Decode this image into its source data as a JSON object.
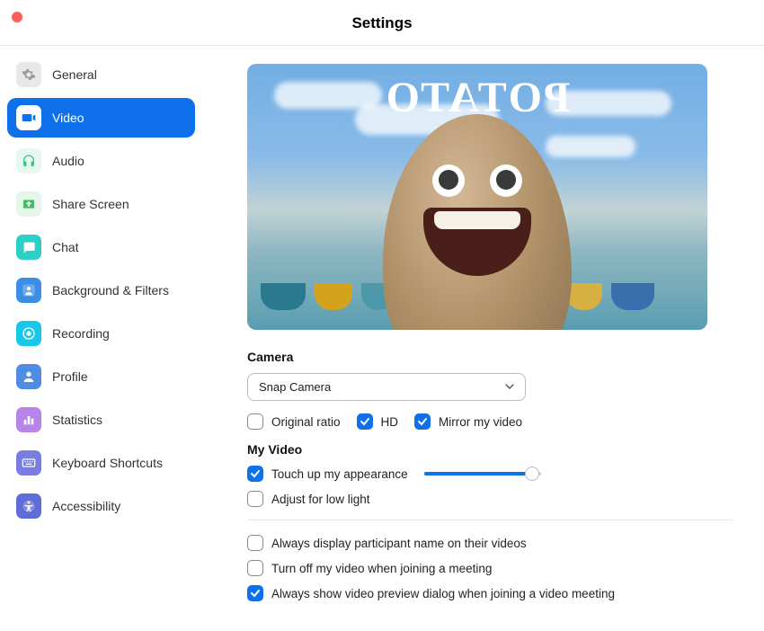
{
  "title": "Settings",
  "sidebar": {
    "items": [
      {
        "label": "General",
        "icon": "gear",
        "bg": "#e8e8e8",
        "fg": "#9a9a9a",
        "active": false
      },
      {
        "label": "Video",
        "icon": "video",
        "bg": "#ffffff",
        "fg": "#0e71eb",
        "active": true
      },
      {
        "label": "Audio",
        "icon": "headphones",
        "bg": "#e8f8f0",
        "fg": "#34c77b",
        "active": false
      },
      {
        "label": "Share Screen",
        "icon": "share",
        "bg": "#e4f7e9",
        "fg": "#3fbf63",
        "active": false
      },
      {
        "label": "Chat",
        "icon": "chat",
        "bg": "#2dd0c4",
        "fg": "#ffffff",
        "active": false
      },
      {
        "label": "Background & Filters",
        "icon": "person-sq",
        "bg": "#3b8ee5",
        "fg": "#ffffff",
        "active": false
      },
      {
        "label": "Recording",
        "icon": "record",
        "bg": "#18c8e8",
        "fg": "#ffffff",
        "active": false
      },
      {
        "label": "Profile",
        "icon": "person",
        "bg": "#4f8de4",
        "fg": "#ffffff",
        "active": false
      },
      {
        "label": "Statistics",
        "icon": "bars",
        "bg": "#b884e8",
        "fg": "#ffffff",
        "active": false
      },
      {
        "label": "Keyboard Shortcuts",
        "icon": "keyboard",
        "bg": "#7a7de0",
        "fg": "#ffffff",
        "active": false
      },
      {
        "label": "Accessibility",
        "icon": "a11y",
        "bg": "#5f6dd8",
        "fg": "#ffffff",
        "active": false
      }
    ]
  },
  "preview": {
    "overlay_text": "POTATO"
  },
  "camera": {
    "heading": "Camera",
    "selected": "Snap Camera",
    "opts": {
      "original_ratio": {
        "label": "Original ratio",
        "checked": false
      },
      "hd": {
        "label": "HD",
        "checked": true
      },
      "mirror": {
        "label": "Mirror my video",
        "checked": true
      }
    }
  },
  "my_video": {
    "heading": "My Video",
    "touch_up": {
      "label": "Touch up my appearance",
      "checked": true
    },
    "low_light": {
      "label": "Adjust for low light",
      "checked": false
    }
  },
  "meeting_opts": {
    "display_name": {
      "label": "Always display participant name on their videos",
      "checked": false
    },
    "turn_off": {
      "label": "Turn off my video when joining a meeting",
      "checked": false
    },
    "preview_dialog": {
      "label": "Always show video preview dialog when joining a video meeting",
      "checked": true
    }
  }
}
